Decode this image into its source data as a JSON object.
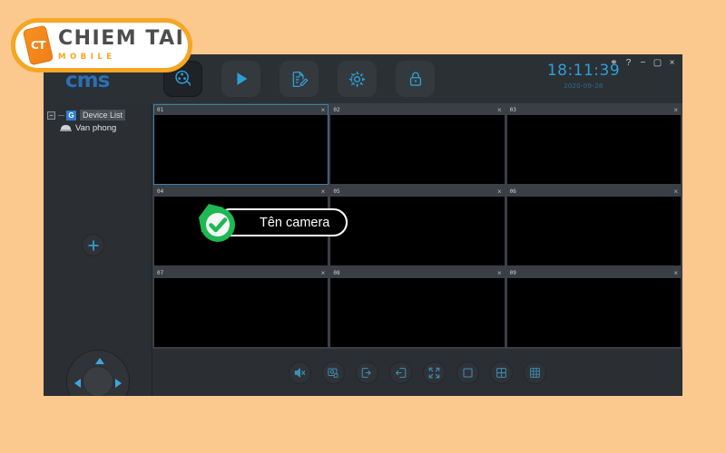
{
  "page": {
    "background_color": "#fbc88e"
  },
  "brand": {
    "badge_mark": "CT",
    "name": "CHIEM TAI",
    "subtitle": "MOBILE",
    "accent_color": "#f5a623"
  },
  "app": {
    "logo": "cms",
    "titlebar_color": "#2b3035",
    "clock": {
      "time": "18:11:39",
      "date": "2020-09-28",
      "time_color": "#2e9fd6"
    },
    "window_controls": [
      {
        "name": "pin-icon",
        "glyph": "⚭"
      },
      {
        "name": "help-icon",
        "glyph": "?"
      },
      {
        "name": "minimize-icon",
        "glyph": "−"
      },
      {
        "name": "maximize-icon",
        "glyph": "▢"
      },
      {
        "name": "close-icon",
        "glyph": "×"
      }
    ],
    "toolbar": [
      {
        "id": "live-view",
        "icon": "film-reel-icon",
        "label": "Live View",
        "active": true
      },
      {
        "id": "playback",
        "icon": "play-icon",
        "label": "Playback",
        "active": false
      },
      {
        "id": "log",
        "icon": "document-edit-icon",
        "label": "Log",
        "active": false
      },
      {
        "id": "settings",
        "icon": "gear-icon",
        "label": "Settings",
        "active": false
      },
      {
        "id": "lock",
        "icon": "lock-icon",
        "label": "Lock",
        "active": false
      }
    ]
  },
  "sidebar": {
    "tree": {
      "expander": "−",
      "group_icon": "G",
      "root_label": "Device List",
      "children": [
        {
          "icon": "camera-dome-icon",
          "label": "Van phong"
        }
      ]
    },
    "add_button": {
      "icon": "plus-icon",
      "label": "+"
    },
    "ptz": {
      "up": "▲",
      "down": "▼",
      "left": "◀",
      "right": "▶"
    }
  },
  "video_grid": {
    "layout": "3x3",
    "close_glyph": "×",
    "selected_index": 0,
    "cells": [
      {
        "number": "01",
        "selected": true
      },
      {
        "number": "02",
        "selected": false
      },
      {
        "number": "03",
        "selected": false
      },
      {
        "number": "04",
        "selected": false
      },
      {
        "number": "05",
        "selected": false
      },
      {
        "number": "06",
        "selected": false
      },
      {
        "number": "07",
        "selected": false
      },
      {
        "number": "08",
        "selected": false
      },
      {
        "number": "09",
        "selected": false
      }
    ]
  },
  "bottom_toolbar": [
    {
      "id": "mute",
      "icon": "speaker-mute-icon",
      "label": "Mute"
    },
    {
      "id": "snapshot",
      "icon": "snapshot-icon",
      "label": "Snapshot"
    },
    {
      "id": "login-all",
      "icon": "login-icon",
      "label": "Connect All"
    },
    {
      "id": "logout-all",
      "icon": "logout-icon",
      "label": "Disconnect All"
    },
    {
      "id": "fullscreen",
      "icon": "fullscreen-icon",
      "label": "Fullscreen"
    },
    {
      "id": "layout-1",
      "icon": "layout-1-icon",
      "label": "1 Window"
    },
    {
      "id": "layout-4",
      "icon": "layout-4-icon",
      "label": "4 Windows"
    },
    {
      "id": "layout-9",
      "icon": "layout-9-icon",
      "label": "9 Windows"
    }
  ],
  "callout": {
    "icon": "green-check-badge-icon",
    "label": "Tên camera",
    "badge_color": "#1db954",
    "border_color": "#ffffff"
  }
}
